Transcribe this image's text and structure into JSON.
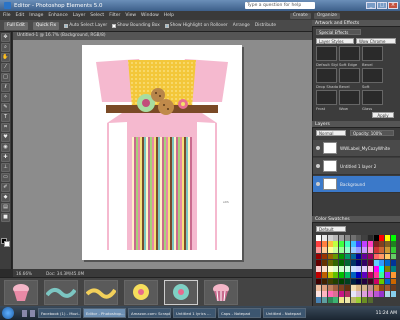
{
  "window": {
    "title": "Editor - Photoshop Elements 5.0",
    "question_placeholder": "Type a question for help"
  },
  "menu": [
    "File",
    "Edit",
    "Image",
    "Enhance",
    "Layer",
    "Select",
    "Filter",
    "View",
    "Window",
    "Help"
  ],
  "menu_right": {
    "create_label": "Create",
    "organize_label": "Organize"
  },
  "options_bar": {
    "edit_full": "Full Edit",
    "quick_fix": "Quick Fix",
    "auto_select": "Auto Select Layer",
    "show_bounding": "Show Bounding Box",
    "show_highlight": "Show Highlight on Rollover",
    "arrange": "Arrange",
    "align": "Distribute"
  },
  "document": {
    "tab": "Untitled-1 @ 16.7% (Background, RGB/8)",
    "zoom": "16.66%",
    "doc_size": "Doc: 34.3M/45.0M",
    "credit": "sDS"
  },
  "right_panel": {
    "artwork_header": "Artwork and Effects",
    "special_effects": "Special Effects",
    "layer_styles": "Layer Styles",
    "style_category": "Wow Chrome",
    "apply": "Apply",
    "effects": [
      "Default Style",
      "Soft Edge",
      "Bevel",
      "Drop Shadow",
      "Bevel",
      "Soft",
      "Frost",
      "Wow",
      "Glass",
      "Inner"
    ],
    "layers_header": "Layers",
    "layers_mode": "Normal",
    "layers_opacity": "Opacity: 100%",
    "layers": [
      {
        "name": "WWLabel_MyCozyWhite",
        "active": false
      },
      {
        "name": "Untitled 1 layer 2",
        "active": false
      },
      {
        "name": "Background",
        "active": true
      }
    ],
    "swatches_header": "Color Swatches",
    "swatches_set": "Default"
  },
  "swatch_colors": [
    "#ffffff",
    "#e8e8e8",
    "#d0d0d0",
    "#b8b8b8",
    "#a0a0a0",
    "#888888",
    "#707070",
    "#585858",
    "#404040",
    "#282828",
    "#000000",
    "#ff0000",
    "#ffff00",
    "#00ff00",
    "#ff4040",
    "#ff8040",
    "#ffc040",
    "#c0ff40",
    "#40ff40",
    "#40ffc0",
    "#40c0ff",
    "#4040ff",
    "#c040ff",
    "#ff40c0",
    "#802020",
    "#804020",
    "#806020",
    "#208020",
    "#ff9999",
    "#ffcc99",
    "#ffff99",
    "#ccff99",
    "#99ff99",
    "#99ffcc",
    "#99ccff",
    "#9999ff",
    "#cc99ff",
    "#ff99cc",
    "#cc3333",
    "#cc6633",
    "#cc9933",
    "#33cc33",
    "#990000",
    "#993300",
    "#996600",
    "#669900",
    "#009900",
    "#009966",
    "#006699",
    "#000099",
    "#660099",
    "#990066",
    "#ff6666",
    "#ff9966",
    "#ffcc66",
    "#66cc66",
    "#660000",
    "#663300",
    "#666600",
    "#336600",
    "#006600",
    "#006633",
    "#003366",
    "#000066",
    "#330066",
    "#660033",
    "#66ccff",
    "#3399ff",
    "#0066cc",
    "#003399",
    "#ffcccc",
    "#ffe0cc",
    "#ffffcc",
    "#e0ffcc",
    "#ccffcc",
    "#ccffe0",
    "#cce0ff",
    "#ccccff",
    "#e0ccff",
    "#ffcce0",
    "#ff00ff",
    "#00ffff",
    "#808000",
    "#008080",
    "#c00000",
    "#c06000",
    "#c0c000",
    "#60c000",
    "#00c000",
    "#00c060",
    "#0060c0",
    "#0000c0",
    "#6000c0",
    "#c00060",
    "#ff3399",
    "#33ff99",
    "#9933ff",
    "#ff9933",
    "#400000",
    "#402000",
    "#404000",
    "#204000",
    "#004000",
    "#004020",
    "#002040",
    "#000040",
    "#200040",
    "#400020",
    "#cc0066",
    "#66cc00",
    "#0066cc",
    "#cc6600",
    "#f0c0a0",
    "#e0a080",
    "#c08060",
    "#a06040",
    "#804020",
    "#603010",
    "#f5deb3",
    "#deb887",
    "#d2b48c",
    "#bc8f8f",
    "#cd853f",
    "#8b4513",
    "#a0522d",
    "#6b3a1e",
    "#ffe4e1",
    "#ffb6c1",
    "#ff69b4",
    "#db7093",
    "#c71585",
    "#b03060",
    "#e6e6fa",
    "#d8bfd8",
    "#dda0dd",
    "#da70d6",
    "#ba55d3",
    "#9932cc",
    "#add8e6",
    "#87ceeb",
    "#4682b4",
    "#5f9ea0",
    "#2e8b57",
    "#3cb371",
    "#f0e68c",
    "#eee8aa",
    "#bdb76b",
    "#9acd32",
    "#6b8e23",
    "#556b2f"
  ],
  "bin_thumbs": [
    "cupcake",
    "ribbon",
    "ribbon2",
    "flower-yellow",
    "flower-teal",
    "cupcake-striped"
  ],
  "taskbar": {
    "items": [
      "Facebook (1) - Mozi...",
      "Editor - Photoshop...",
      "Amazon.com: Scrapb...",
      "Untitled 1 lyrics ...",
      "Caps - Notepad",
      "Untitled - Notepad"
    ],
    "clock": "11:24 AM"
  }
}
